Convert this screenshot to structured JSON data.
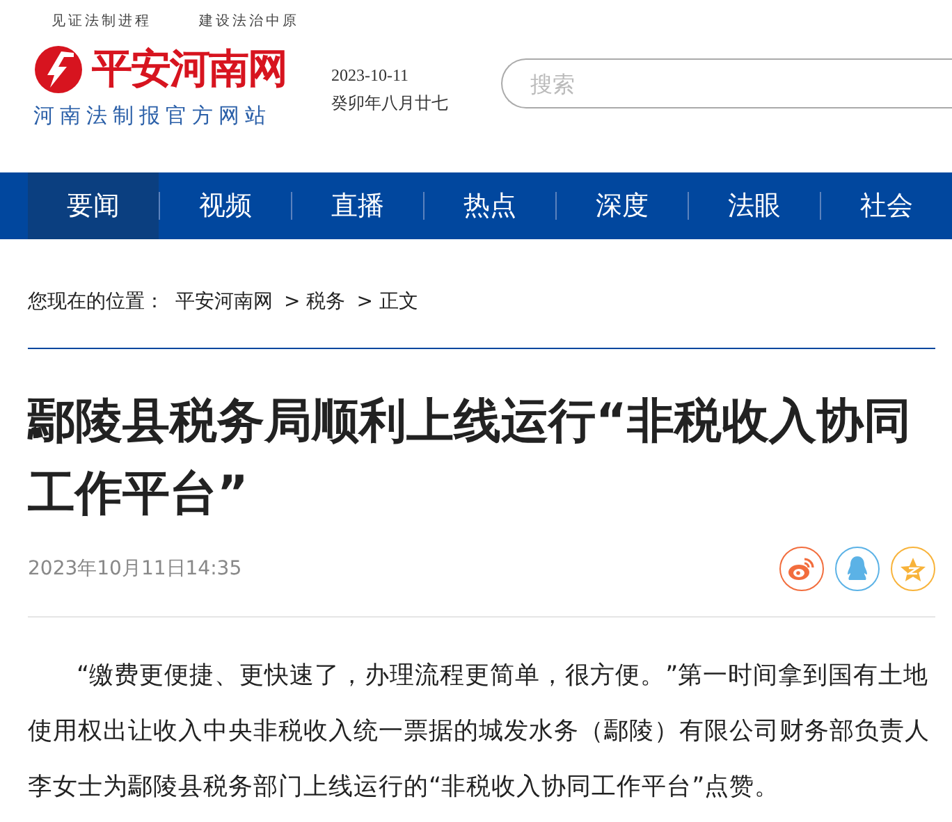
{
  "header": {
    "slogans": [
      "见证法制进程",
      "建设法治中原"
    ],
    "logo": {
      "name": "平安河南网",
      "subtitle": "河南法制报官方网站"
    },
    "date": "2023-10-11",
    "lunar_date": "癸卯年八月廿七",
    "search": {
      "placeholder": "搜索"
    }
  },
  "nav": [
    {
      "label": "要闻",
      "selected": true
    },
    {
      "label": "视频",
      "selected": false
    },
    {
      "label": "直播",
      "selected": false
    },
    {
      "label": "热点",
      "selected": false
    },
    {
      "label": "深度",
      "selected": false
    },
    {
      "label": "法眼",
      "selected": false
    },
    {
      "label": "社会",
      "selected": false
    }
  ],
  "breadcrumb": {
    "label": "您现在的位置：",
    "items": [
      "平安河南网",
      "> 税务",
      "> 正文"
    ]
  },
  "article": {
    "title": "鄢陵县税务局顺利上线运行“非税收入协同工作平台”",
    "published": "2023年10月11日14:35",
    "share": [
      {
        "kind": "weibo",
        "color": "#f26d3d"
      },
      {
        "kind": "qq",
        "color": "#5bb2e6"
      },
      {
        "kind": "qzone",
        "color": "#f8b33a"
      }
    ],
    "paragraphs": [
      "“缴费更便捷、更快速了，办理流程更简单，很方便。”第一时间拿到国有土地使用权出让收入中央非税收入统一票据的城发水务（鄢陵）有限公司财务部负责人李女士为鄢陵县税务部门上线运行的“非税收入协同工作平台”点赞。"
    ]
  }
}
